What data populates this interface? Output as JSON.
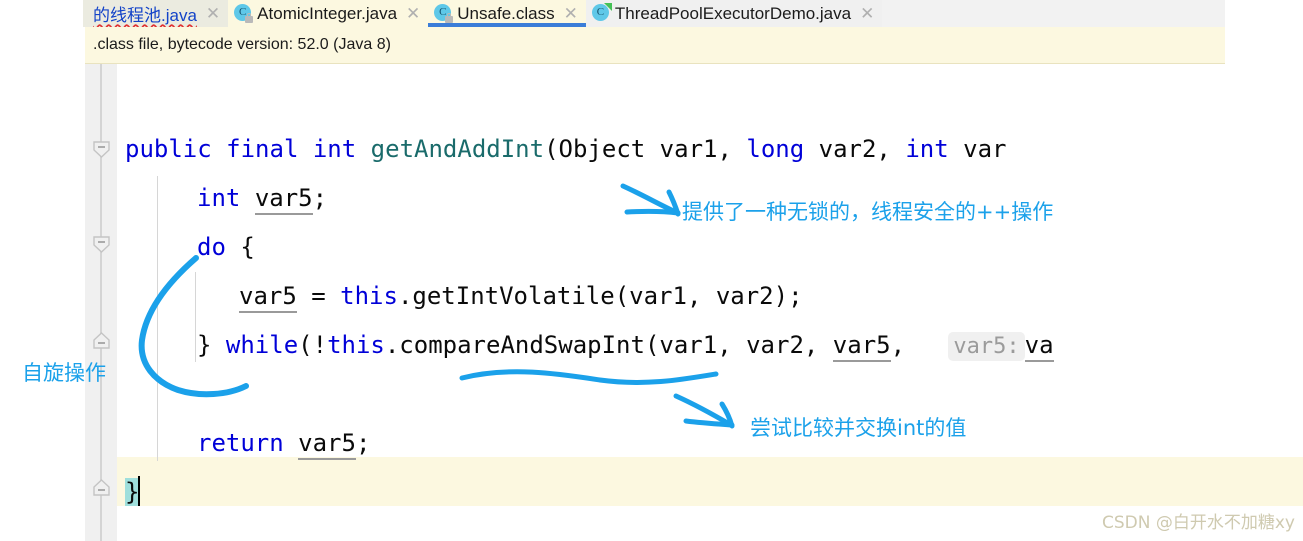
{
  "tabs": [
    {
      "label": "的线程池.java",
      "icon": "java-class-file-icon",
      "state": "modified",
      "closable": true
    },
    {
      "label": "AtomicInteger.java",
      "icon": "java-class-file-locked-icon",
      "state": "inactive",
      "closable": true
    },
    {
      "label": "Unsafe.class",
      "icon": "java-class-file-locked-icon",
      "state": "active",
      "closable": true
    },
    {
      "label": "ThreadPoolExecutorDemo.java",
      "icon": "java-runnable-class-icon",
      "state": "inactive",
      "closable": true
    }
  ],
  "notification": {
    "message": ".class file, bytecode version: 52.0 (Java 8)"
  },
  "code": {
    "line1": {
      "kw_public": "public",
      "kw_final": "final",
      "kw_int": "int",
      "method": "getAndAddInt",
      "paren": "(",
      "p1_type": "Object",
      "p1_name": "var1,",
      "p2_type": "long",
      "p2_name": "var2,",
      "p3_type": "int",
      "p3_name": "var"
    },
    "line2": {
      "kw": "int",
      "name": "var5",
      "semi": ";"
    },
    "line3": {
      "kw": "do",
      "brace": "{"
    },
    "line4": {
      "target": "var5",
      "eq": " = ",
      "kw_this": "this",
      "call": ".getIntVolatile(var1, var2);"
    },
    "line5": {
      "close": "} ",
      "kw_while": "while",
      "open": "(!",
      "kw_this": "this",
      "call": ".compareAndSwapInt(var1, var2, ",
      "arg_var5": "var5",
      "comma": ", ",
      "hint": "var5:",
      "hint_arg": "va"
    },
    "line7": {
      "kw": "return",
      "name": "var5",
      "semi": ";"
    },
    "line8": {
      "brace": "}"
    }
  },
  "annotations": [
    {
      "name": "annotation-lockfree-note",
      "text": "提供了一种无锁的，线程安全的++操作",
      "color": "#1ba1ea"
    },
    {
      "name": "annotation-spin-operation",
      "text": "自旋操作",
      "color": "#1ba1ea"
    },
    {
      "name": "annotation-cas-note",
      "text": "尝试比较并交换int的值",
      "color": "#1ba1ea"
    }
  ],
  "watermark": {
    "text": "CSDN @白开水不加糖xy"
  },
  "colors": {
    "accent_tab_underline": "#3b7dd8",
    "notification_bg": "#fcf8e0",
    "keyword": "#0000d8",
    "method": "#1a6b6b",
    "annotation_ink": "#1ba1ea",
    "brace_match": "#9fdfdc",
    "current_line": "#fcf8e0"
  }
}
